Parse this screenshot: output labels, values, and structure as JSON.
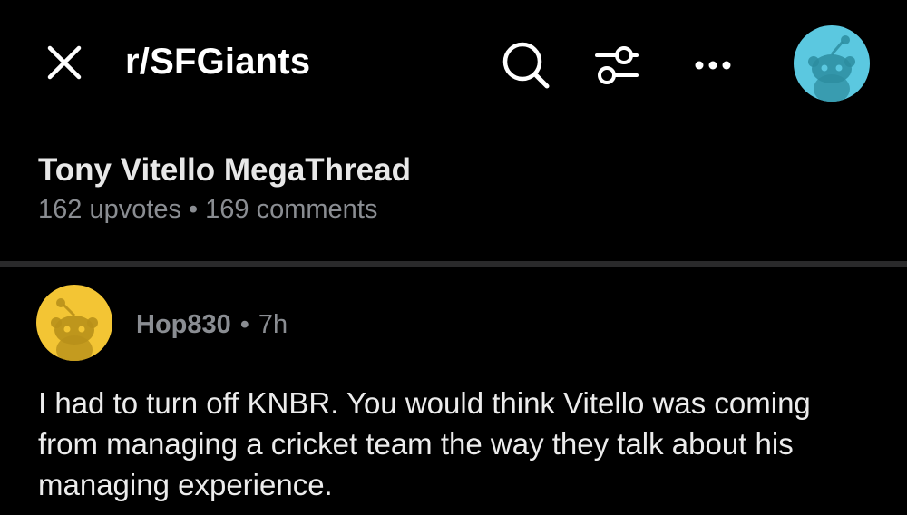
{
  "header": {
    "subreddit": "r/SFGiants",
    "icons": [
      "close-icon",
      "search-icon",
      "filter-icon",
      "more-icon",
      "avatar"
    ]
  },
  "post": {
    "title": "Tony Vitello MegaThread",
    "upvotes": "162 upvotes",
    "separator": "•",
    "comments": "169 comments"
  },
  "comment": {
    "username": "Hop830",
    "separator": "•",
    "time": "7h",
    "body": "I had to turn off KNBR. You would think Vitello was coming from managing a cricket team the way they talk about his managing experience."
  },
  "colors": {
    "background": "#000000",
    "avatar_top": "#5bc8e0",
    "avatar_comment": "#f3c534",
    "meta_text": "#8a8d92"
  }
}
